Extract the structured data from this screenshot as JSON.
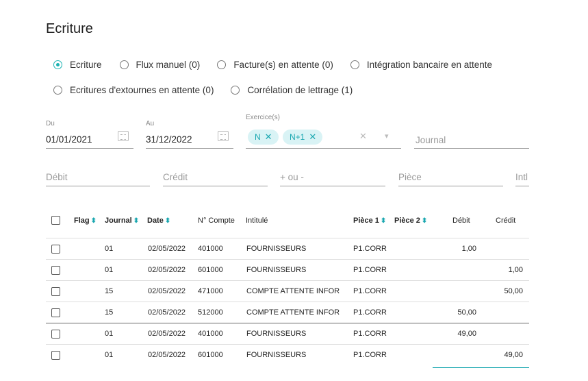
{
  "page": {
    "title": "Ecriture"
  },
  "radios_row1": [
    {
      "label": "Ecriture",
      "selected": true
    },
    {
      "label": "Flux manuel (0)",
      "selected": false
    },
    {
      "label": "Facture(s) en attente (0)",
      "selected": false
    },
    {
      "label": "Intégration bancaire en attente",
      "selected": false
    }
  ],
  "radios_row2": [
    {
      "label": "Ecritures d'extournes en attente (0)",
      "selected": false
    },
    {
      "label": "Corrélation de lettrage (1)",
      "selected": false
    }
  ],
  "filters": {
    "du_label": "Du",
    "du_value": "01/01/2021",
    "au_label": "Au",
    "au_value": "31/12/2022",
    "exercice_label": "Exercice(s)",
    "chips": [
      "N",
      "N+1"
    ],
    "clear_symbol": "✕",
    "dropdown_symbol": "▾",
    "journal_placeholder": "Journal",
    "debit_placeholder": "Débit",
    "credit_placeholder": "Crédit",
    "plusminus_placeholder": "+ ou -",
    "piece_placeholder": "Pièce",
    "intitule_placeholder": "Intl"
  },
  "table": {
    "headers": {
      "flag": "Flag",
      "journal": "Journal",
      "date": "Date",
      "compte": "N° Compte",
      "intitule": "Intitulé",
      "piece1": "Pièce 1",
      "piece2": "Pièce 2",
      "debit": "Débit",
      "credit": "Crédit"
    },
    "sort_symbol": "⬍",
    "rows": [
      {
        "journal": "01",
        "date": "02/05/2022",
        "compte": "401000",
        "intitule": "FOURNISSEURS",
        "piece1": "P1.CORR",
        "debit": "1,00",
        "credit": ""
      },
      {
        "journal": "01",
        "date": "02/05/2022",
        "compte": "601000",
        "intitule": "FOURNISSEURS",
        "piece1": "P1.CORR",
        "debit": "",
        "credit": "1,00"
      },
      {
        "journal": "15",
        "date": "02/05/2022",
        "compte": "471000",
        "intitule": "COMPTE ATTENTE INFOR",
        "piece1": "P1.CORR",
        "debit": "",
        "credit": "50,00"
      },
      {
        "journal": "15",
        "date": "02/05/2022",
        "compte": "512000",
        "intitule": "COMPTE ATTENTE INFOR",
        "piece1": "P1.CORR",
        "debit": "50,00",
        "credit": ""
      },
      {
        "journal": "01",
        "date": "02/05/2022",
        "compte": "401000",
        "intitule": "FOURNISSEURS",
        "piece1": "P1.CORR",
        "debit": "49,00",
        "credit": ""
      },
      {
        "journal": "01",
        "date": "02/05/2022",
        "compte": "601000",
        "intitule": "FOURNISSEURS",
        "piece1": "P1.CORR",
        "debit": "",
        "credit": "49,00"
      }
    ]
  },
  "colors": {
    "accent": "#1bb3b3"
  }
}
